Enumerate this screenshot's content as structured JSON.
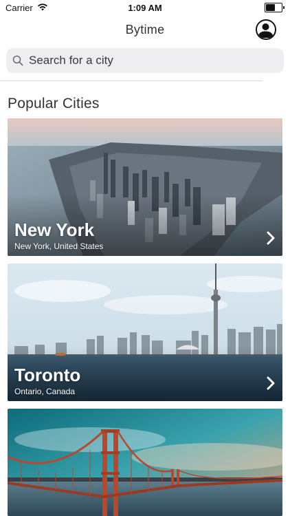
{
  "status_bar": {
    "carrier": "Carrier",
    "time": "1:09 AM",
    "battery_level": 0.6
  },
  "nav": {
    "title": "Bytime",
    "profile_icon": "person-circle-icon"
  },
  "search": {
    "placeholder": "Search for a city",
    "icon": "search-icon"
  },
  "section": {
    "title": "Popular Cities"
  },
  "cities": [
    {
      "name": "New York",
      "subtitle": "New York, United States"
    },
    {
      "name": "Toronto",
      "subtitle": "Ontario, Canada"
    },
    {
      "name": "",
      "subtitle": ""
    }
  ]
}
